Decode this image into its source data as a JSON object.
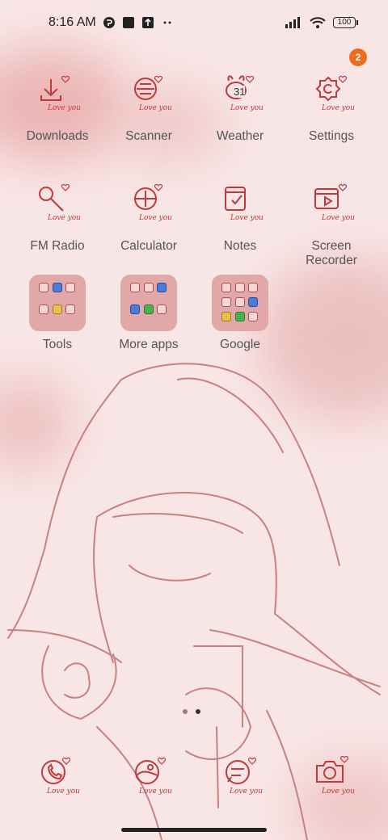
{
  "status_bar": {
    "time": "8:16 AM",
    "battery": "100",
    "notification_icons": [
      "notification-app-icon",
      "notification-square-icon",
      "upload-icon",
      "more-dots-icon"
    ],
    "system_icons": [
      "signal-icon",
      "wifi-icon",
      "battery-icon"
    ]
  },
  "apps": [
    {
      "label": "Downloads",
      "icon": "download-icon"
    },
    {
      "label": "Scanner",
      "icon": "scanner-icon"
    },
    {
      "label": "Weather",
      "icon": "weather-icon",
      "date_text": "31"
    },
    {
      "label": "Settings",
      "icon": "settings-icon",
      "badge": "2"
    },
    {
      "label": "FM Radio",
      "icon": "microphone-icon"
    },
    {
      "label": "Calculator",
      "icon": "calculator-icon"
    },
    {
      "label": "Notes",
      "icon": "notes-icon"
    },
    {
      "label": "Screen Recorder",
      "icon": "screen-recorder-icon"
    }
  ],
  "folders": [
    {
      "label": "Tools"
    },
    {
      "label": "More apps"
    },
    {
      "label": "Google"
    }
  ],
  "dock": [
    {
      "icon": "phone-icon"
    },
    {
      "icon": "gallery-icon"
    },
    {
      "icon": "messages-icon"
    },
    {
      "icon": "camera-icon"
    }
  ],
  "colors": {
    "icon_stroke": "#c0393b",
    "background": "#f8e6e6",
    "badge": "#f06a1e",
    "label": "#555555"
  }
}
